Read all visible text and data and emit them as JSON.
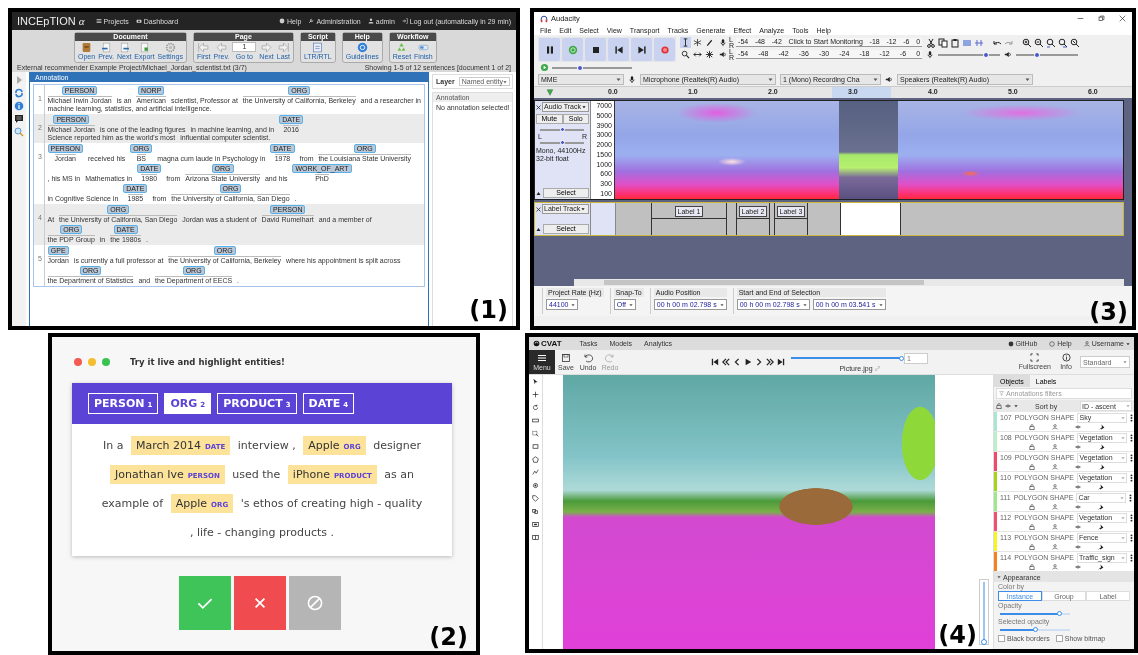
{
  "inception": {
    "logo": "INCEpTION",
    "logo_mark": "α",
    "nav": [
      "Projects",
      "Dashboard"
    ],
    "user_nav": [
      "Help",
      "Administration",
      "admin",
      "Log out (automatically in 29 min)"
    ],
    "toolbar": [
      {
        "title": "Document",
        "buttons": [
          {
            "kind": "icon",
            "label": "Open"
          },
          {
            "kind": "icon",
            "label": "Prev."
          },
          {
            "kind": "icon",
            "label": "Next"
          },
          {
            "kind": "icon",
            "label": "Export"
          },
          {
            "kind": "icon",
            "label": "Settings"
          }
        ]
      },
      {
        "title": "Page",
        "buttons": [
          {
            "kind": "icon",
            "label": "First"
          },
          {
            "kind": "icon",
            "label": "Prev."
          },
          {
            "kind": "goto",
            "label": "Go to",
            "value": "1"
          },
          {
            "kind": "icon",
            "label": "Next"
          },
          {
            "kind": "icon",
            "label": "Last"
          }
        ]
      },
      {
        "title": "Script",
        "buttons": [
          {
            "kind": "icon",
            "label": "LTR/RTL"
          }
        ]
      },
      {
        "title": "Help",
        "buttons": [
          {
            "kind": "icon",
            "label": "Guidelines"
          }
        ]
      },
      {
        "title": "Workflow",
        "buttons": [
          {
            "kind": "icon",
            "label": "Reset"
          },
          {
            "kind": "icon",
            "label": "Finish"
          }
        ]
      }
    ],
    "document_path": "External recommender Example Project/Michael_Jordan_scientist.txt (3/7)",
    "sentence_count": "Showing 1-5 of 12 sentences [document 1 of 2]",
    "annotation_title": "Annotation",
    "sentences": [
      {
        "number": "1",
        "segments": [
          {
            "text": "Michael Irwin Jordan",
            "entity": "PERSON"
          },
          {
            "text": "is an"
          },
          {
            "text": "American",
            "entity": "NORP"
          },
          {
            "text": "scientist, Professor at"
          },
          {
            "text": "the University of California, Berkeley",
            "entity": "ORG"
          },
          {
            "text": "and a researcher in"
          },
          {
            "text": "machine learning, statistics, and artificial intelligence."
          }
        ]
      },
      {
        "number": "2",
        "segments": [
          {
            "text": "Michael Jordan",
            "entity": "PERSON"
          },
          {
            "text": "is one of the leading figures"
          },
          {
            "text": "in machine learning, and in"
          },
          {
            "text": "2016",
            "entity": "DATE"
          },
          {
            "text": "Science reported him as the world's most"
          },
          {
            "text": "influential computer scientist."
          }
        ]
      },
      {
        "number": "3",
        "segments": [
          {
            "text": "Jordan",
            "entity": "PERSON"
          },
          {
            "text": "received his"
          },
          {
            "text": "BS",
            "entity": "ORG"
          },
          {
            "text": "magna cum laude in Psychology in"
          },
          {
            "text": "1978",
            "entity": "DATE"
          },
          {
            "text": "from"
          },
          {
            "text": "the Louisiana State University",
            "entity": "ORG"
          },
          {
            "text": ", his MS in"
          },
          {
            "text": "Mathematics in"
          },
          {
            "text": "1980",
            "entity": "DATE"
          },
          {
            "text": "from"
          },
          {
            "text": "Arizona State University",
            "entity": "ORG"
          },
          {
            "text": "and his"
          },
          {
            "text": "PhD",
            "entity": "WORK_OF_ART"
          },
          {
            "text": "in Cognitive Science in"
          },
          {
            "text": "1985",
            "entity": "DATE"
          },
          {
            "text": "from"
          },
          {
            "text": "the University of California, San Diego",
            "entity": "ORG"
          },
          {
            "text": "."
          }
        ]
      },
      {
        "number": "4",
        "segments": [
          {
            "text": "At"
          },
          {
            "text": "the University of California, San Diego",
            "entity": "ORG"
          },
          {
            "text": "Jordan was a student of"
          },
          {
            "text": "David Rumelhart",
            "entity": "PERSON"
          },
          {
            "text": "and a member of"
          },
          {
            "text": "the PDP Group",
            "entity": "ORG"
          },
          {
            "text": "in"
          },
          {
            "text": "the 1980s",
            "entity": "DATE"
          },
          {
            "text": "."
          }
        ]
      },
      {
        "number": "5",
        "segments": [
          {
            "text": "Jordan",
            "entity": "GPE"
          },
          {
            "text": "is currently a full professor at"
          },
          {
            "text": "the University of California, Berkeley",
            "entity": "ORG"
          },
          {
            "text": "where his appointment is split across"
          },
          {
            "text": "the Department of Statistics",
            "entity": "ORG"
          },
          {
            "text": "and"
          },
          {
            "text": "the Department of EECS",
            "entity": "ORG"
          },
          {
            "text": "."
          }
        ]
      }
    ],
    "layer_label": "Layer",
    "layer": "Named entity",
    "detail_title": "Annotation",
    "detail_text": "No annotation selected!",
    "panel_label": "(1)"
  },
  "audacity": {
    "title": "Audacity",
    "menu": [
      "File",
      "Edit",
      "Select",
      "View",
      "Transport",
      "Tracks",
      "Generate",
      "Effect",
      "Analyze",
      "Tools",
      "Help"
    ],
    "record_meter": {
      "channels": [
        "L",
        "R"
      ],
      "scale": [
        "-54",
        "-48",
        "-42",
        "Click to Start Monitoring",
        "-18",
        "-12",
        "-6",
        "0"
      ]
    },
    "play_meter": {
      "channels": [
        "L",
        "R"
      ],
      "scale": [
        "-54",
        "-48",
        "-42",
        "-36",
        "-30",
        "-24",
        "-18",
        "-12",
        "-6",
        "0"
      ]
    },
    "sliders": [
      {
        "level": 0.78
      },
      {
        "level": 0.33
      }
    ],
    "speed_slider": {
      "level": 0.35
    },
    "devices": [
      "MME",
      "Microphone (Realtek(R) Audio)",
      "1 (Mono) Recording Cha",
      "Speakers (Realtek(R) Audio)"
    ],
    "timeline": [
      "0.0",
      "1.0",
      "2.0",
      "3.0",
      "4.0",
      "5.0",
      "6.0"
    ],
    "audio_track": {
      "name": "Audio Track",
      "buttons": [
        "Mute",
        "Solo"
      ],
      "gain": {
        "level": 0.5
      },
      "pan": {
        "left": "L",
        "right": "R",
        "level": 0.5
      },
      "info": "Mono, 44100Hz",
      "format": "32-bit float",
      "select": "Select",
      "scale": [
        "7000",
        "5000",
        "3900",
        "3000",
        "2000",
        "1500",
        "1000",
        "600",
        "300",
        "100"
      ]
    },
    "label_track": {
      "name": "Label Track",
      "select": "Select",
      "labels": [
        "Label 1",
        "Label 2",
        "Label 3"
      ]
    },
    "selection_bar": [
      {
        "label": "Project Rate (Hz)",
        "values": [
          "44100"
        ]
      },
      {
        "label": "Snap-To",
        "values": [
          "Off"
        ]
      },
      {
        "label": "Audio Position",
        "values": [
          "00 h 00 m 02.798 s"
        ]
      },
      {
        "label": "Start and End of Selection",
        "values": [
          "00 h 00 m 02.798 s",
          "00 h 00 m 03.541 s"
        ]
      }
    ],
    "panel_label": "(3)"
  },
  "demo": {
    "dots": [
      {
        "color": "#f25a52"
      },
      {
        "color": "#f5bd2f"
      },
      {
        "color": "#38c350"
      }
    ],
    "title": "Try it live and highlight entities!",
    "tabs": [
      {
        "label": "PERSON",
        "key": "1",
        "selected": false
      },
      {
        "label": "ORG",
        "key": "2",
        "selected": true
      },
      {
        "label": "PRODUCT",
        "key": "3",
        "selected": false
      },
      {
        "label": "DATE",
        "key": "4",
        "selected": false
      }
    ],
    "text": [
      {
        "text": "In a"
      },
      {
        "text": "March 2014",
        "entity": "DATE"
      },
      {
        "text": "interview ,"
      },
      {
        "text": "Apple",
        "entity": "ORG"
      },
      {
        "text": "designer"
      },
      {
        "text": "Jonathan Ive",
        "entity": "PERSON"
      },
      {
        "text": "used the"
      },
      {
        "text": "iPhone",
        "entity": "PRODUCT"
      },
      {
        "text": "as an"
      },
      {
        "text": "example of"
      },
      {
        "text": "Apple",
        "entity": "ORG"
      },
      {
        "text": "'s ethos of creating high - quality"
      },
      {
        "text": ", life - changing products ."
      }
    ],
    "buttons": [
      {
        "kind": "accept"
      },
      {
        "kind": "reject"
      },
      {
        "kind": "ignore"
      }
    ],
    "panel_label": "(2)"
  },
  "cvat": {
    "logo": "CVAT",
    "nav": [
      "Tasks",
      "Models",
      "Analytics"
    ],
    "right_nav": [
      "GitHub",
      "Help",
      "Username"
    ],
    "tools": [
      {
        "label": "Menu",
        "disabled": false
      },
      {
        "label": "Save",
        "disabled": false
      },
      {
        "label": "Undo",
        "disabled": false
      },
      {
        "label": "Redo",
        "disabled": true
      }
    ],
    "frame_slider": {
      "level": 1
    },
    "frame": "1",
    "filename": "Picture.jpg",
    "view_tools": [
      "Fullscreen",
      "Info"
    ],
    "workspace": "Standard",
    "tabs": [
      {
        "label": "Objects",
        "selected": true
      },
      {
        "label": "Labels",
        "selected": false
      }
    ],
    "filter_placeholder": "Annotations filters",
    "sort_label": "Sort by",
    "sort": "ID - ascent",
    "objects": [
      {
        "id": "107",
        "type": "POLYGON SHAPE",
        "label": "Sky",
        "color": "#a8e8d0"
      },
      {
        "id": "108",
        "type": "POLYGON SHAPE",
        "label": "Vegetation",
        "color": "#b8f0c8"
      },
      {
        "id": "109",
        "type": "POLYGON SHAPE",
        "label": "Vegetation",
        "color": "#f04a68"
      },
      {
        "id": "110",
        "type": "POLYGON SHAPE",
        "label": "Vegetation",
        "color": "#a4d41c"
      },
      {
        "id": "111",
        "type": "POLYGON SHAPE",
        "label": "Car",
        "color": "#9ee88c"
      },
      {
        "id": "112",
        "type": "POLYGON SHAPE",
        "label": "Vegetation",
        "color": "#f0506e"
      },
      {
        "id": "113",
        "type": "POLYGON SHAPE",
        "label": "Fence",
        "color": "#f5f520"
      },
      {
        "id": "114",
        "type": "POLYGON SHAPE",
        "label": "Traffic_sign",
        "color": "#f5821e"
      }
    ],
    "appearance": "Appearance",
    "color_by_label": "Color by",
    "color_by": [
      {
        "label": "Instance",
        "selected": true
      },
      {
        "label": "Group",
        "selected": false
      },
      {
        "label": "Label",
        "selected": false
      }
    ],
    "opacity": {
      "label": "Opacity",
      "level": 0.85
    },
    "selected_opacity": {
      "label": "Selected opacity",
      "level": 0.5
    },
    "checks": [
      {
        "label": "Black borders",
        "checked": false
      },
      {
        "label": "Show bitmap",
        "checked": false
      }
    ],
    "zoom_slider": {
      "level": 0
    },
    "panel_label": "(4)"
  }
}
